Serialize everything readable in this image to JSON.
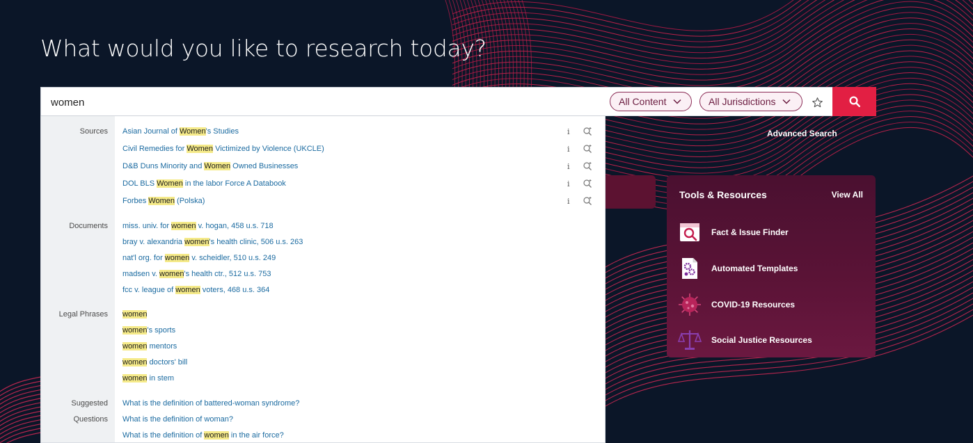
{
  "headline": "What would you like to research today?",
  "search": {
    "value": "women",
    "content_filter": "All Content",
    "jurisdiction_filter": "All Jurisdictions"
  },
  "advanced_search": "Advanced Search",
  "tools": {
    "title": "Tools & Resources",
    "view_all": "View All",
    "items": [
      {
        "label": "Fact & Issue Finder",
        "icon": "fact-finder-icon"
      },
      {
        "label": "Automated Templates",
        "icon": "automated-templates-icon"
      },
      {
        "label": "COVID-19 Resources",
        "icon": "covid-virus-icon"
      },
      {
        "label": "Social Justice Resources",
        "icon": "scales-of-justice-icon"
      }
    ]
  },
  "suggestions": {
    "sources_label": "Sources",
    "sources": [
      {
        "pre": "Asian Journal of ",
        "match": "Women",
        "post": "'s Studies"
      },
      {
        "pre": "Civil Remedies for ",
        "match": "Women",
        "post": " Victimized by Violence (UKCLE)"
      },
      {
        "pre": "D&B Duns Minority and ",
        "match": "Women",
        "post": " Owned Businesses"
      },
      {
        "pre": "DOL BLS ",
        "match": "Women",
        "post": " in the labor Force A Databook"
      },
      {
        "pre": "Forbes ",
        "match": "Women",
        "post": " (Polska)"
      }
    ],
    "documents_label": "Documents",
    "documents": [
      {
        "pre": "miss. univ. for ",
        "match": "women",
        "post": " v. hogan, 458 u.s. 718"
      },
      {
        "pre": "bray v. alexandria ",
        "match": "women",
        "post": "'s health clinic, 506 u.s. 263"
      },
      {
        "pre": "nat'l org. for ",
        "match": "women",
        "post": " v. scheidler, 510 u.s. 249"
      },
      {
        "pre": "madsen v. ",
        "match": "women",
        "post": "'s health ctr., 512 u.s. 753"
      },
      {
        "pre": "fcc v. league of ",
        "match": "women",
        "post": " voters, 468 u.s. 364"
      }
    ],
    "phrases_label": "Legal Phrases",
    "phrases": [
      {
        "pre": "",
        "match": "women",
        "post": ""
      },
      {
        "pre": "",
        "match": "women",
        "post": "'s sports"
      },
      {
        "pre": "",
        "match": "women",
        "post": " mentors"
      },
      {
        "pre": "",
        "match": "women",
        "post": " doctors' bill"
      },
      {
        "pre": "",
        "match": "women",
        "post": " in stem"
      }
    ],
    "questions_label_1": "Suggested",
    "questions_label_2": "Questions",
    "questions": [
      {
        "pre": "What is the definition of battered-woman syndrome?",
        "match": "",
        "post": ""
      },
      {
        "pre": "What is the definition of woman?",
        "match": "",
        "post": ""
      },
      {
        "pre": "What is the definition of ",
        "match": "women",
        "post": " in the air force?"
      }
    ],
    "info_glyph": "i"
  },
  "colors": {
    "background": "#0b1628",
    "accent_red": "#e21f43",
    "pill_border": "#8a2b55",
    "highlight": "#f5ea89",
    "link": "#1a6aa0"
  }
}
